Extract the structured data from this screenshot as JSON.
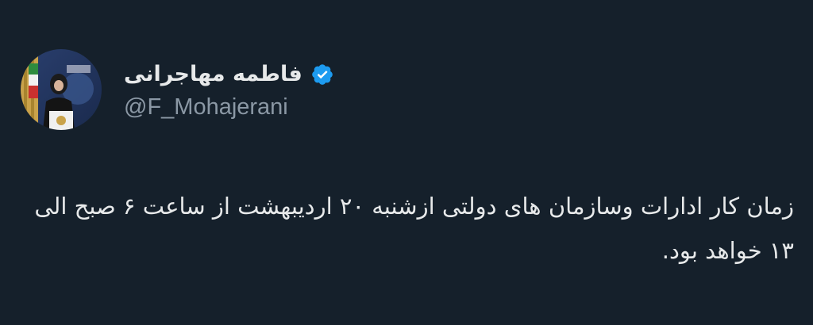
{
  "tweet": {
    "author": {
      "display_name": "فاطمه مهاجرانی",
      "handle": "@F_Mohajerani",
      "verified_icon": "verified-badge-icon",
      "avatar_icon": "profile-avatar"
    },
    "text": "زمان کار ادارات وسازمان های دولتی ازشنبه ۲۰ اردیبهشت از ساعت ۶ صبح الی ۱۳ خواهد بود."
  },
  "colors": {
    "background": "#15202b",
    "primary_text": "#e7e9ea",
    "secondary_text": "#8b98a5",
    "verified_blue": "#1d9bf0"
  }
}
